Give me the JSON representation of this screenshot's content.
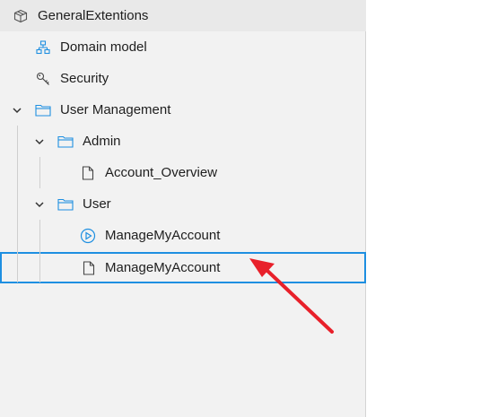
{
  "tree": {
    "items": [
      {
        "label": "GeneralExtentions",
        "icon": "package-icon"
      },
      {
        "label": "Domain model",
        "icon": "domain-model-icon"
      },
      {
        "label": "Security",
        "icon": "key-icon"
      },
      {
        "label": "User Management",
        "icon": "folder-icon",
        "expanded": true
      },
      {
        "label": "Admin",
        "icon": "folder-icon",
        "expanded": true
      },
      {
        "label": "Account_Overview",
        "icon": "page-icon"
      },
      {
        "label": "User",
        "icon": "folder-icon",
        "expanded": true
      },
      {
        "label": "ManageMyAccount",
        "icon": "microflow-icon"
      },
      {
        "label": "ManageMyAccount",
        "icon": "page-icon",
        "selected": true
      }
    ]
  },
  "colors": {
    "accent": "#1e8fe1",
    "annotation_arrow": "#e8202a"
  }
}
